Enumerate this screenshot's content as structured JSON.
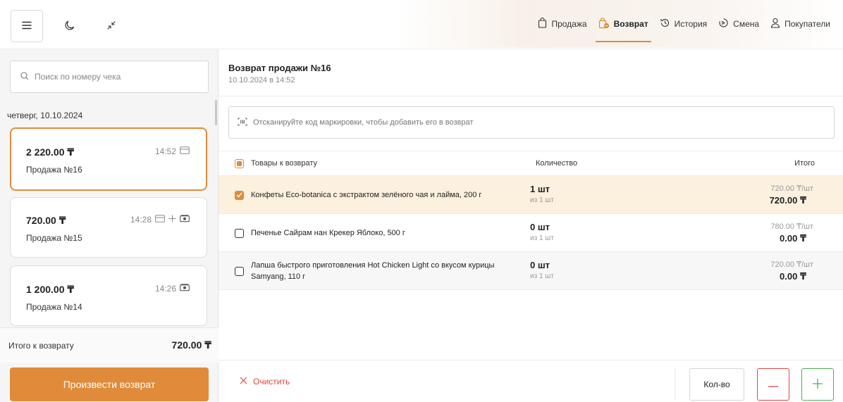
{
  "nav": {
    "items": [
      {
        "label": "Продажа",
        "icon": "bag-icon",
        "active": false
      },
      {
        "label": "Возврат",
        "icon": "bag-return-icon",
        "active": true
      },
      {
        "label": "История",
        "icon": "history-icon",
        "active": false
      },
      {
        "label": "Смена",
        "icon": "shift-icon",
        "active": false
      },
      {
        "label": "Покупатели",
        "icon": "customers-icon",
        "active": false
      }
    ]
  },
  "left": {
    "search_placeholder": "Поиск по номеру чека",
    "date_label": "четверг, 10.10.2024",
    "receipts": [
      {
        "amount": "2 220.00 ₸",
        "time": "14:52",
        "name": "Продажа №16",
        "payments": [
          "card-icon"
        ]
      },
      {
        "amount": "720.00 ₸",
        "time": "14:28",
        "name": "Продажа №15",
        "payments": [
          "card-icon",
          "plus-icon",
          "cash-icon"
        ]
      },
      {
        "amount": "1 200.00 ₸",
        "time": "14:26",
        "name": "Продажа №14",
        "payments": [
          "cash-icon"
        ]
      }
    ],
    "total_label": "Итого к возврату",
    "total_value": "720.00 ₸",
    "refund_button": "Произвести возврат"
  },
  "right": {
    "title": "Возврат продажи №16",
    "date": "10.10.2024 в 14:52",
    "scan_placeholder": "Отсканируйте код маркировки, чтобы добавить его в возврат",
    "columns": {
      "name": "Товары к возврату",
      "qty": "Количество",
      "total": "Итого"
    },
    "rows": [
      {
        "name": "Конфеты Eco-botanica с экстрактом зелёного чая и лайма, 200 г",
        "qty": "1 шт",
        "of": "из 1 шт",
        "unit_price": "720.00 ₸/шт",
        "sum": "720.00 ₸",
        "checked": true
      },
      {
        "name": "Печенье Сайрам нан Крекер Яблоко, 500 г",
        "qty": "0 шт",
        "of": "из 1 шт",
        "unit_price": "780.00 ₸/шт",
        "sum": "0.00 ₸",
        "checked": false
      },
      {
        "name": "Лапша быстрого приготовления Hot Chicken Light со вкусом курицы Samyang, 110 г",
        "qty": "0 шт",
        "of": "из 1 шт",
        "unit_price": "720.00 ₸/шт",
        "sum": "0.00 ₸",
        "checked": false
      }
    ],
    "clear_button": "Очистить",
    "qty_button": "Кол-во"
  },
  "colors": {
    "accent": "#df8b3a",
    "danger": "#e0443d",
    "success": "#4caf50",
    "highlight_row": "#fcf0de"
  }
}
